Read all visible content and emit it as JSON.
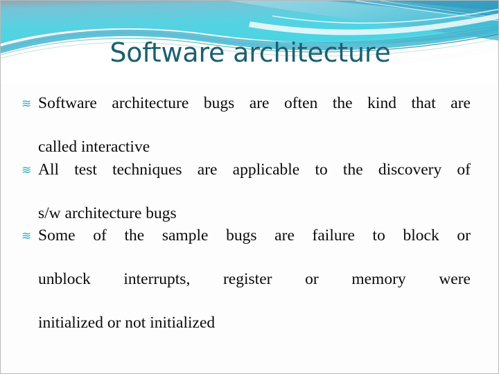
{
  "slide": {
    "title": "Software architecture",
    "title_color": "#1c5f70",
    "background_color": "#fdfdfd",
    "accent_color": "#2fb2c4",
    "body_text_color": "#0a0a0a",
    "bullet_glyph": "≋",
    "bullet_glyph_name": "swirl-bullet"
  },
  "bullets": [
    {
      "marker": "≋",
      "text": "Software architecture bugs are often the kind that are called interactive",
      "lines": [
        "Software architecture bugs are often the kind that are",
        "called interactive"
      ]
    },
    {
      "marker": "≋",
      "text": "All test techniques are applicable to the discovery of s/w architecture bugs",
      "lines": [
        "All test techniques are applicable to the discovery of",
        "s/w architecture bugs"
      ]
    },
    {
      "marker": "≋",
      "text": "Some of the sample bugs are failure to block or unblock interrupts, register or memory were initialized or not initialized",
      "lines": [
        "Some of the sample bugs are failure to block or",
        "unblock interrupts, register or memory were",
        "initialized or not initialized"
      ]
    }
  ]
}
